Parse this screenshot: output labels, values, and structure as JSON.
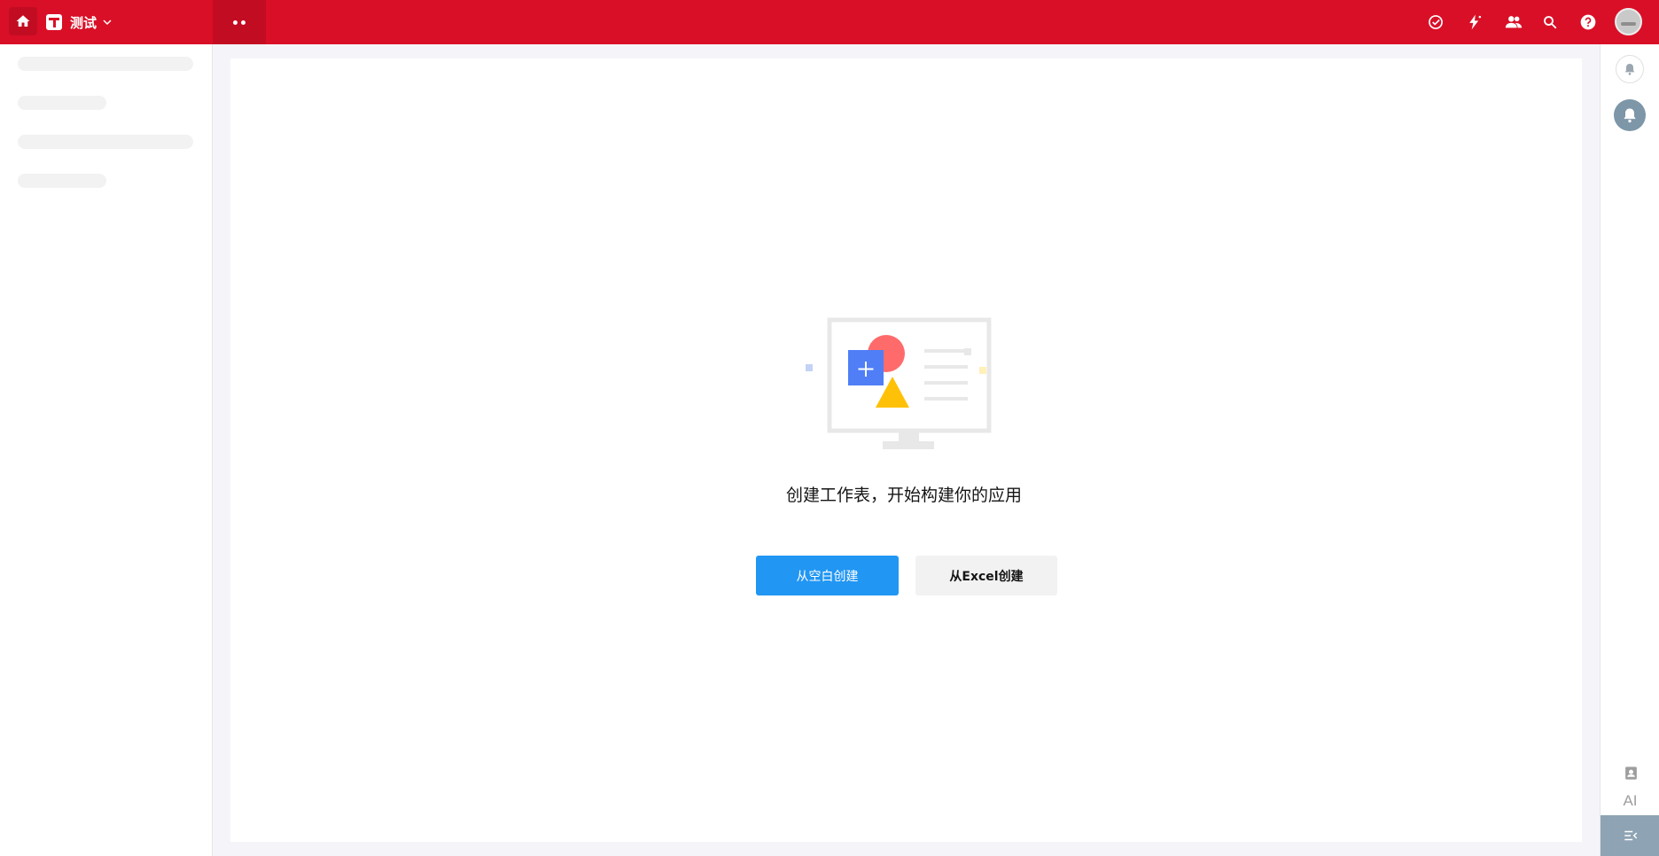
{
  "header": {
    "app_name": "测试",
    "icons": [
      "home-icon",
      "app-icon",
      "chevron-down-icon",
      "more-dots-icon",
      "task-check-icon",
      "workflow-icon",
      "contacts-icon",
      "search-icon",
      "help-icon",
      "avatar"
    ]
  },
  "main": {
    "empty_title": "创建工作表，开始构建你的应用",
    "btn_blank": "从空白创建",
    "btn_excel": "从Excel创建"
  },
  "rightbar": {
    "ai_label": "AI",
    "icons": [
      "bell-outline-icon",
      "bell-filled-icon",
      "contact-card-icon",
      "collapse-icon"
    ]
  },
  "colors": {
    "brand": "#d90f27",
    "primary_button": "#2196f3",
    "secondary_button": "#f2f2f2",
    "rail_accent": "#8ea3b3"
  }
}
